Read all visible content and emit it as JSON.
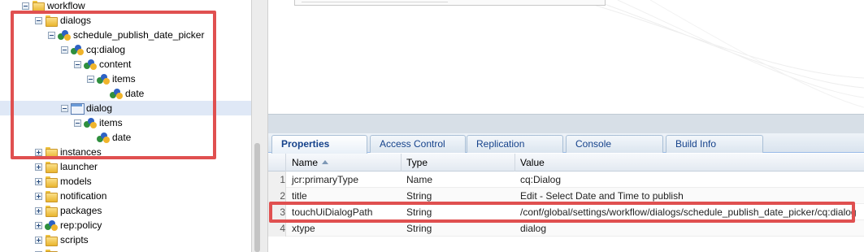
{
  "tree": {
    "rows": [
      {
        "label": "workflow",
        "icon": "folder-icon",
        "toggle": "minus"
      },
      {
        "label": "dialogs",
        "icon": "folder-icon",
        "toggle": "minus"
      },
      {
        "label": "schedule_publish_date_picker",
        "icon": "node-icon",
        "toggle": "minus"
      },
      {
        "label": "cq:dialog",
        "icon": "node-icon",
        "toggle": "minus"
      },
      {
        "label": "content",
        "icon": "node-icon",
        "toggle": "minus"
      },
      {
        "label": "items",
        "icon": "node-icon",
        "toggle": "minus"
      },
      {
        "label": "date",
        "icon": "node-icon",
        "toggle": "none"
      },
      {
        "label": "dialog",
        "icon": "dialog-icon",
        "toggle": "minus",
        "selected": true
      },
      {
        "label": "items",
        "icon": "node-icon",
        "toggle": "minus"
      },
      {
        "label": "date",
        "icon": "node-icon",
        "toggle": "none"
      },
      {
        "label": "instances",
        "icon": "folder-icon",
        "toggle": "plus"
      },
      {
        "label": "launcher",
        "icon": "folder-icon",
        "toggle": "plus"
      },
      {
        "label": "models",
        "icon": "folder-icon",
        "toggle": "plus"
      },
      {
        "label": "notification",
        "icon": "folder-icon",
        "toggle": "plus"
      },
      {
        "label": "packages",
        "icon": "folder-icon",
        "toggle": "plus"
      },
      {
        "label": "rep:policy",
        "icon": "node-icon",
        "toggle": "plus"
      },
      {
        "label": "scripts",
        "icon": "folder-icon",
        "toggle": "plus"
      }
    ]
  },
  "tabs": [
    {
      "label": "Properties",
      "active": true
    },
    {
      "label": "Access Control"
    },
    {
      "label": "Replication"
    },
    {
      "label": "Console"
    },
    {
      "label": "Build Info"
    }
  ],
  "grid": {
    "columns": {
      "name": "Name",
      "type": "Type",
      "value": "Value"
    },
    "rows": [
      {
        "num": "1",
        "name": "jcr:primaryType",
        "type": "Name",
        "value": "cq:Dialog"
      },
      {
        "num": "2",
        "name": "title",
        "type": "String",
        "value": "Edit - Select Date and Time to publish"
      },
      {
        "num": "3",
        "name": "touchUiDialogPath",
        "type": "String",
        "value": "/conf/global/settings/workflow/dialogs/schedule_publish_date_picker/cq:dialog"
      },
      {
        "num": "4",
        "name": "xtype",
        "type": "String",
        "value": "dialog"
      }
    ]
  },
  "colors": {
    "highlight": "#e05050",
    "selection": "#dfe8f6",
    "tab_text": "#15428b"
  }
}
